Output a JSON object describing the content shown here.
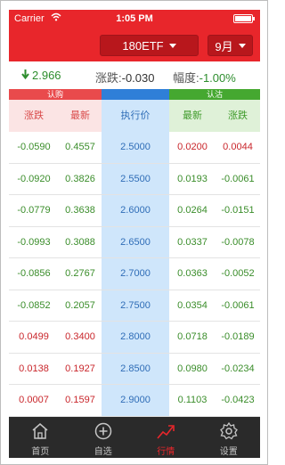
{
  "status_bar": {
    "carrier": "Carrier",
    "time": "1:05 PM",
    "battery_level": 1.0
  },
  "header": {
    "underlying": "180ETF",
    "month": "9月"
  },
  "quote": {
    "price": "2.966",
    "change_label": "涨跌:",
    "change_value": "-0.030",
    "amplitude_label": "幅度:",
    "amplitude_value": "-1.00%"
  },
  "table": {
    "group_call": "认购",
    "group_put": "认沽",
    "columns": {
      "call_change": "涨跌",
      "call_latest": "最新",
      "strike": "执行价",
      "put_latest": "最新",
      "put_change": "涨跌"
    },
    "rows": [
      {
        "call_change": "-0.0590",
        "call_latest": "0.4557",
        "strike": "2.5000",
        "put_latest": "0.0200",
        "put_change": "0.0044",
        "call_color": "green",
        "put_latest_color": "red",
        "put_change_color": "red"
      },
      {
        "call_change": "-0.0920",
        "call_latest": "0.3826",
        "strike": "2.5500",
        "put_latest": "0.0193",
        "put_change": "-0.0061",
        "call_color": "green",
        "put_latest_color": "green",
        "put_change_color": "green"
      },
      {
        "call_change": "-0.0779",
        "call_latest": "0.3638",
        "strike": "2.6000",
        "put_latest": "0.0264",
        "put_change": "-0.0151",
        "call_color": "green",
        "put_latest_color": "green",
        "put_change_color": "green"
      },
      {
        "call_change": "-0.0993",
        "call_latest": "0.3088",
        "strike": "2.6500",
        "put_latest": "0.0337",
        "put_change": "-0.0078",
        "call_color": "green",
        "put_latest_color": "green",
        "put_change_color": "green"
      },
      {
        "call_change": "-0.0856",
        "call_latest": "0.2767",
        "strike": "2.7000",
        "put_latest": "0.0363",
        "put_change": "-0.0052",
        "call_color": "green",
        "put_latest_color": "green",
        "put_change_color": "green"
      },
      {
        "call_change": "-0.0852",
        "call_latest": "0.2057",
        "strike": "2.7500",
        "put_latest": "0.0354",
        "put_change": "-0.0061",
        "call_color": "green",
        "put_latest_color": "green",
        "put_change_color": "green"
      },
      {
        "call_change": "0.0499",
        "call_latest": "0.3400",
        "strike": "2.8000",
        "put_latest": "0.0718",
        "put_change": "-0.0189",
        "call_color": "red",
        "put_latest_color": "green",
        "put_change_color": "green"
      },
      {
        "call_change": "0.0138",
        "call_latest": "0.1927",
        "strike": "2.8500",
        "put_latest": "0.0980",
        "put_change": "-0.0234",
        "call_color": "red",
        "put_latest_color": "green",
        "put_change_color": "green"
      },
      {
        "call_change": "0.0007",
        "call_latest": "0.1597",
        "strike": "2.9000",
        "put_latest": "0.1103",
        "put_change": "-0.0423",
        "call_color": "red",
        "put_latest_color": "green",
        "put_change_color": "green"
      }
    ]
  },
  "tabs": [
    {
      "label": "首页",
      "icon": "home-icon",
      "active": false
    },
    {
      "label": "自选",
      "icon": "plus-circle-icon",
      "active": false
    },
    {
      "label": "行情",
      "icon": "trend-icon",
      "active": true
    },
    {
      "label": "设置",
      "icon": "gear-icon",
      "active": false
    }
  ],
  "colors": {
    "brand_red": "#e8262b",
    "up": "#c9262b",
    "down": "#3a8d2a",
    "strike_blue": "#2f6db7"
  }
}
